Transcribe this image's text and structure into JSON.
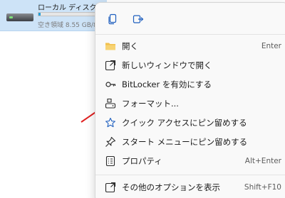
{
  "drive": {
    "name": "ローカル ディスク (E:)",
    "free_space": "空き領域 8.55 GB/8",
    "usage_fraction": 0.03
  },
  "context_menu": {
    "quick_actions": [
      {
        "icon": "copy-icon"
      },
      {
        "icon": "share-icon"
      }
    ],
    "items": [
      {
        "label": "開く",
        "shortcut": "Enter",
        "icon": "folder-icon"
      },
      {
        "label": "新しいウィンドウで開く",
        "shortcut": "",
        "icon": "open-new-window-icon"
      },
      {
        "label": "BitLocker を有効にする",
        "shortcut": "",
        "icon": "key-icon"
      },
      {
        "label": "フォーマット...",
        "shortcut": "",
        "icon": "format-drive-icon"
      },
      {
        "label": "クイック アクセスにピン留めする",
        "shortcut": "",
        "icon": "star-icon"
      },
      {
        "label": "スタート メニューにピン留めする",
        "shortcut": "",
        "icon": "pin-icon"
      },
      {
        "label": "プロパティ",
        "shortcut": "Alt+Enter",
        "icon": "properties-icon"
      },
      {
        "label": "その他のオプションを表示",
        "shortcut": "Shift+F10",
        "icon": "more-options-icon"
      }
    ]
  },
  "colors": {
    "accent": "#0067c0",
    "folder": "#f2c14e",
    "annotation": "#e02020"
  }
}
